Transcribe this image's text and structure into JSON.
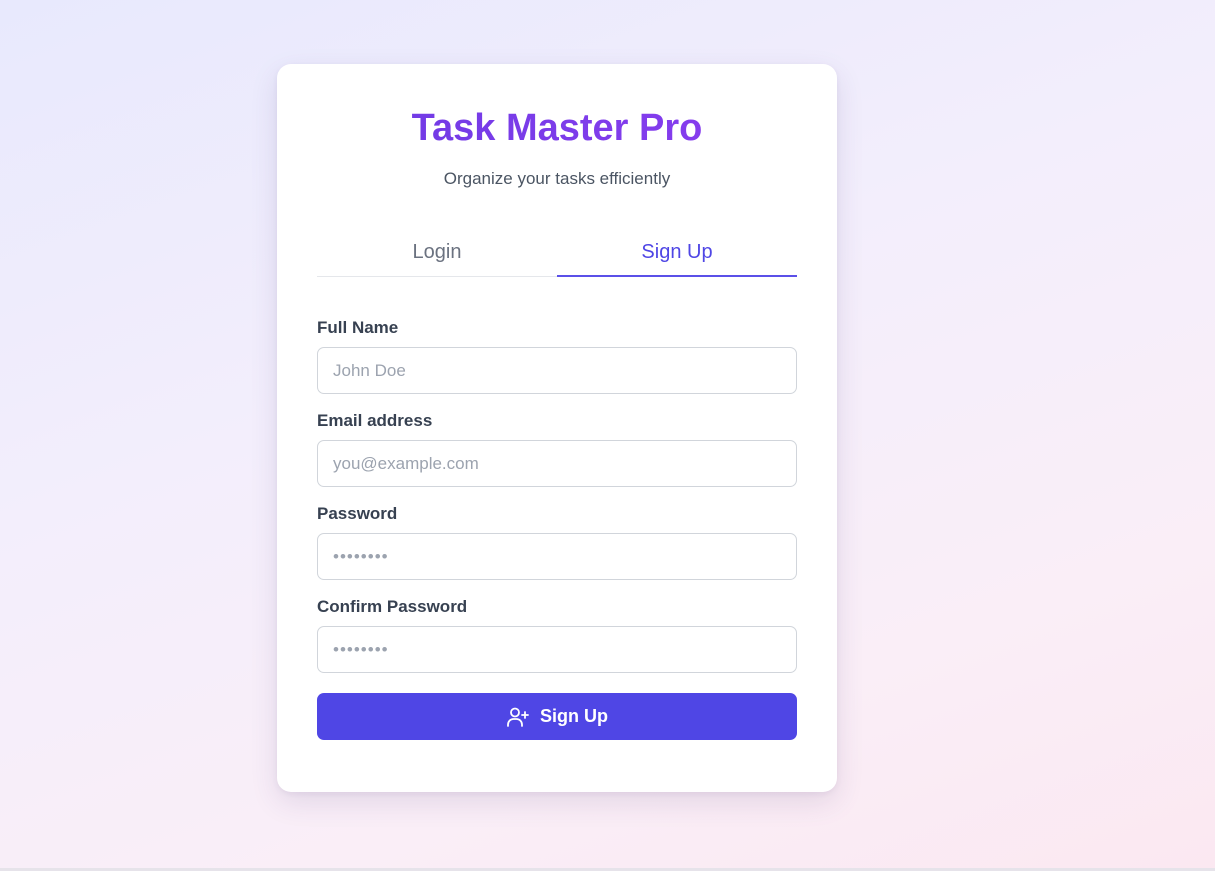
{
  "header": {
    "title": "Task Master Pro",
    "subtitle": "Organize your tasks efficiently"
  },
  "tabs": [
    {
      "label": "Login",
      "active": false
    },
    {
      "label": "Sign Up",
      "active": true
    }
  ],
  "form": {
    "full_name": {
      "label": "Full Name",
      "placeholder": "John Doe",
      "value": ""
    },
    "email": {
      "label": "Email address",
      "placeholder": "you@example.com",
      "value": ""
    },
    "password": {
      "label": "Password",
      "placeholder": "••••••••",
      "value": ""
    },
    "confirm_password": {
      "label": "Confirm Password",
      "placeholder": "••••••••",
      "value": ""
    },
    "submit": {
      "label": "Sign Up",
      "icon": "user-plus-icon"
    }
  },
  "colors": {
    "brand": "#7c3aed",
    "accent": "#4f46e5"
  }
}
